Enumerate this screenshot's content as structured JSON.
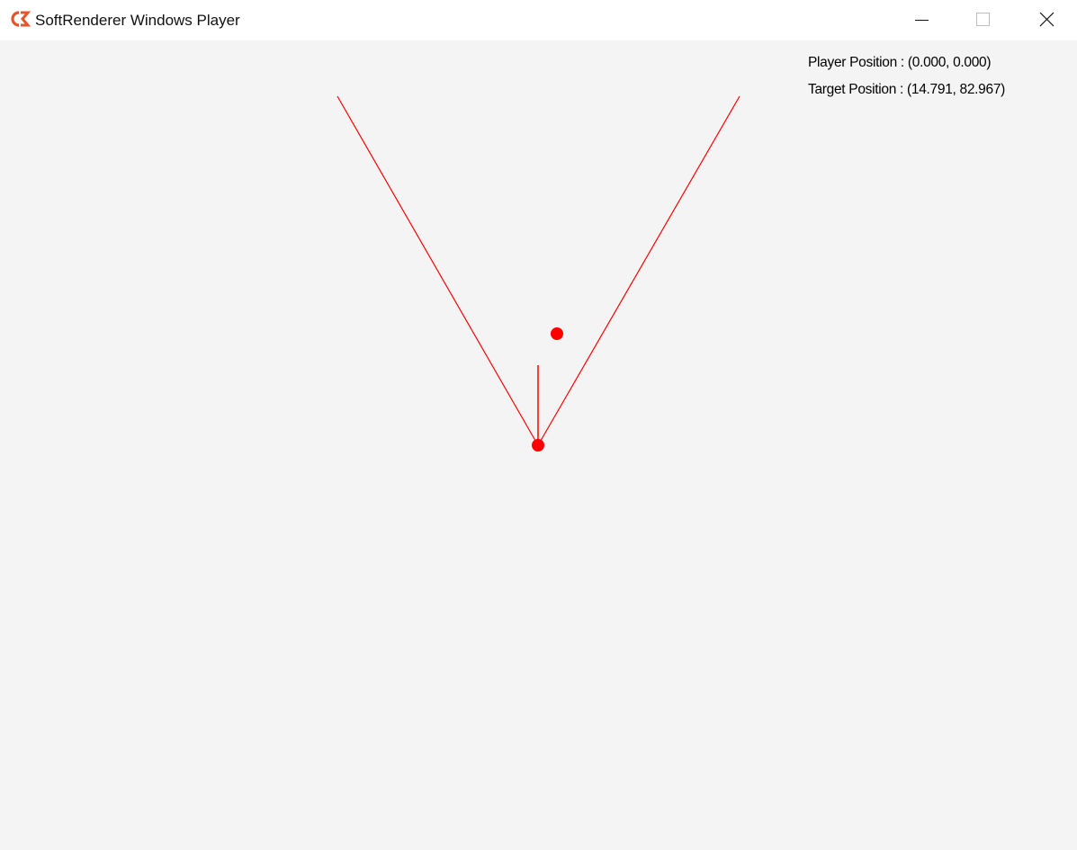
{
  "window": {
    "title": "SoftRenderer Windows Player",
    "app_icon": "softrenderer-logo-icon",
    "buttons": {
      "minimize_icon": "minimize-icon",
      "maximize_icon": "maximize-icon",
      "close_icon": "close-icon"
    }
  },
  "hud": {
    "player_position": "Player Position : (0.000, 0.000)",
    "target_position": "Target Position : (14.791, 82.967)"
  },
  "scene": {
    "player": {
      "x": 0.0,
      "y": 0.0
    },
    "target": {
      "x": 14.791,
      "y": 82.967
    },
    "colors": {
      "background": "#f4f4f4",
      "draw": "#ff0000",
      "logo": "#e8542a"
    }
  }
}
